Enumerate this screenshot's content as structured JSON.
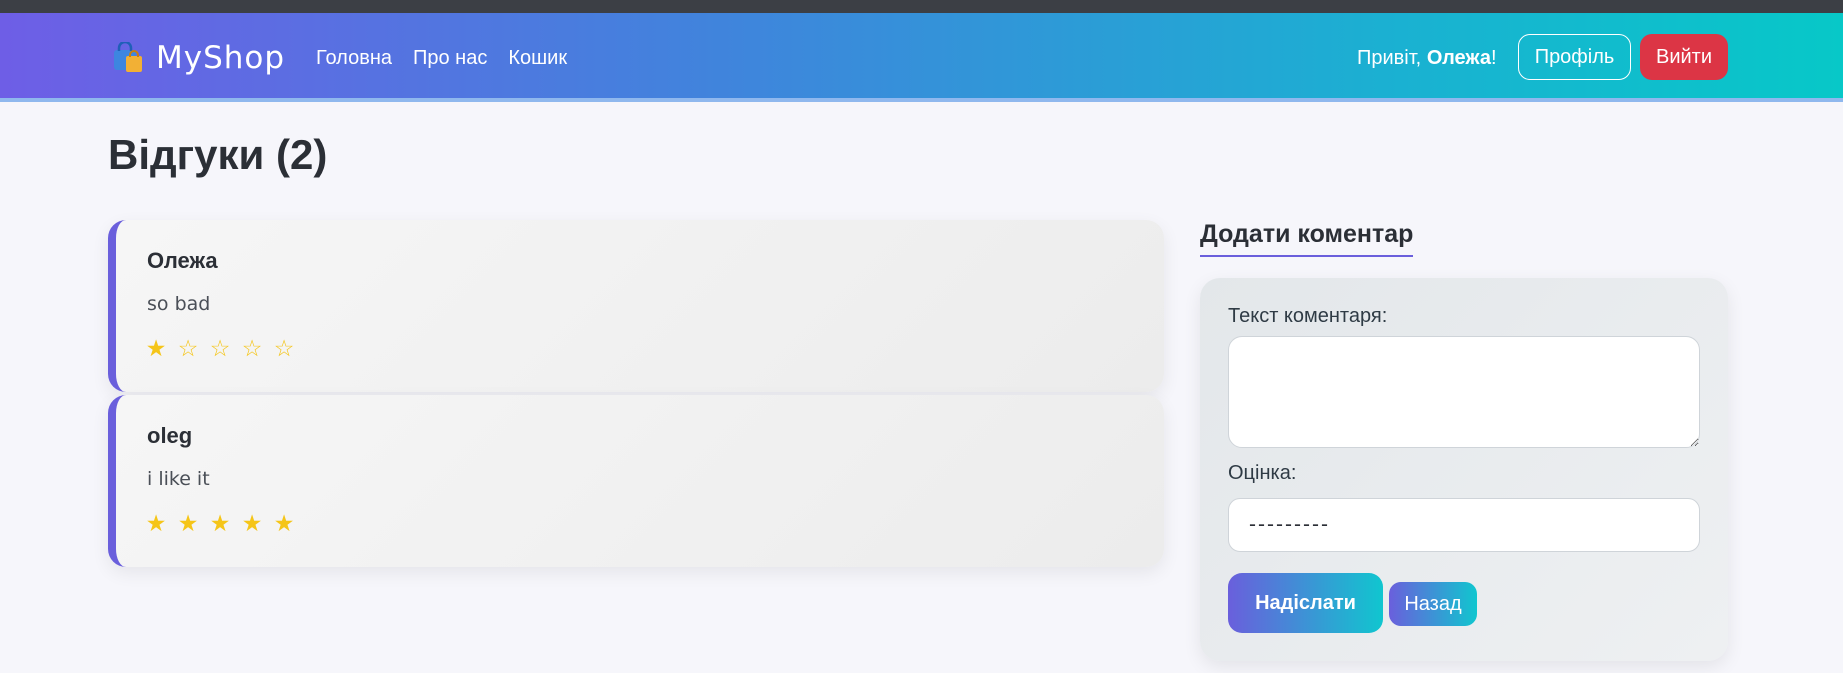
{
  "navbar": {
    "brand": "MyShop",
    "brand_icon": "shopping-bag-icon",
    "links": [
      {
        "label": "Головна"
      },
      {
        "label": "Про нас"
      },
      {
        "label": "Кошик"
      }
    ],
    "greeting_prefix": "Привіт,",
    "greeting_user": "Олежа",
    "greeting_suffix": "!",
    "profile_label": "Профіль",
    "logout_label": "Вийти"
  },
  "page": {
    "title": "Відгуки (2)"
  },
  "reviews": [
    {
      "author": "Олежа",
      "text": "so bad",
      "rating": 1,
      "max_rating": 5
    },
    {
      "author": "oleg",
      "text": "i like it",
      "rating": 5,
      "max_rating": 5
    }
  ],
  "comment_form": {
    "heading": "Додати коментар",
    "text_label": "Текст коментаря:",
    "text_value": "",
    "rating_label": "Оцінка:",
    "rating_selected": "---------",
    "submit_label": "Надіслати",
    "back_label": "Назад"
  },
  "colors": {
    "accent": "#6a5fdc",
    "star": "#f5c518",
    "logout": "#dc3545",
    "teal": "#10c6cf"
  }
}
